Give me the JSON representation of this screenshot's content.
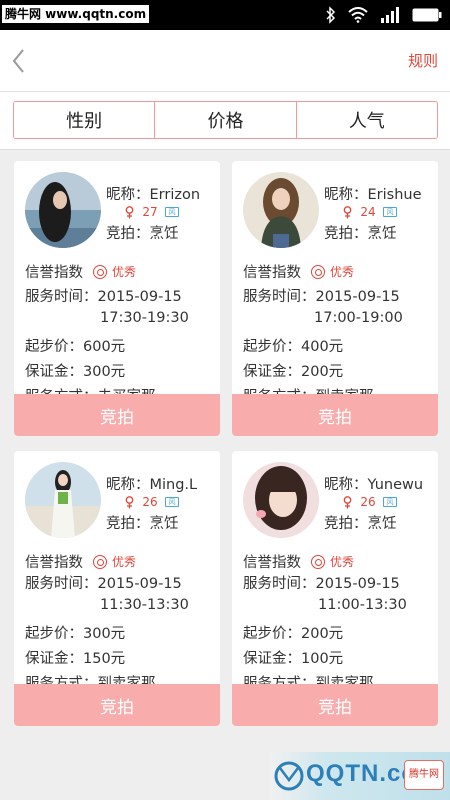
{
  "watermark": "腾牛网 www.qqtn.com",
  "header": {
    "back_icon": "chevron-left-icon",
    "rules_label": "规则"
  },
  "filters": [
    "性别",
    "价格",
    "人气"
  ],
  "cards": [
    {
      "nickname": "昵称：Errizon",
      "age": "27",
      "tag": "风",
      "bid_type": "竞拍：烹饪",
      "credit_label": "信誉指数",
      "credit_level": "优秀",
      "service_time": "服务时间：2015-09-15",
      "service_hours": "17:30-19:30",
      "start_price": "起步价：600元",
      "deposit": "保证金：300元",
      "service_mode": "服务方式：去买家那",
      "bid_button": "竞拍"
    },
    {
      "nickname": "昵称：Erishue",
      "age": "24",
      "tag": "风",
      "bid_type": "竞拍：烹饪",
      "credit_label": "信誉指数",
      "credit_level": "优秀",
      "service_time": "服务时间：2015-09-15",
      "service_hours": "17:00-19:00",
      "start_price": "起步价：400元",
      "deposit": "保证金：200元",
      "service_mode": "服务方式：到卖家那",
      "bid_button": "竞拍"
    },
    {
      "nickname": "昵称：Ming.L",
      "age": "26",
      "tag": "风",
      "bid_type": "竞拍：烹饪",
      "credit_label": "信誉指数",
      "credit_level": "优秀",
      "service_time": "服务时间：2015-09-15",
      "service_hours": "11:30-13:30",
      "start_price": "起步价：300元",
      "deposit": "保证金：150元",
      "service_mode": "服务方式：到卖家那",
      "bid_button": "竞拍"
    },
    {
      "nickname": "昵称：Yunewu",
      "age": "26",
      "tag": "风",
      "bid_type": "竞拍：烹饪",
      "credit_label": "信誉指数",
      "credit_level": "优秀",
      "service_time": "服务时间：2015-09-15",
      "service_hours": "11:00-13:30",
      "start_price": "起步价：200元",
      "deposit": "保证金：100元",
      "service_mode": "服务方式：到卖家那",
      "bid_button": "竞拍"
    }
  ],
  "logo": {
    "text": "QQTN.com",
    "badge": "腾牛网"
  },
  "colors": {
    "accent": "#e0463a",
    "button": "#f8acac",
    "filter_border": "#f19a9a"
  }
}
